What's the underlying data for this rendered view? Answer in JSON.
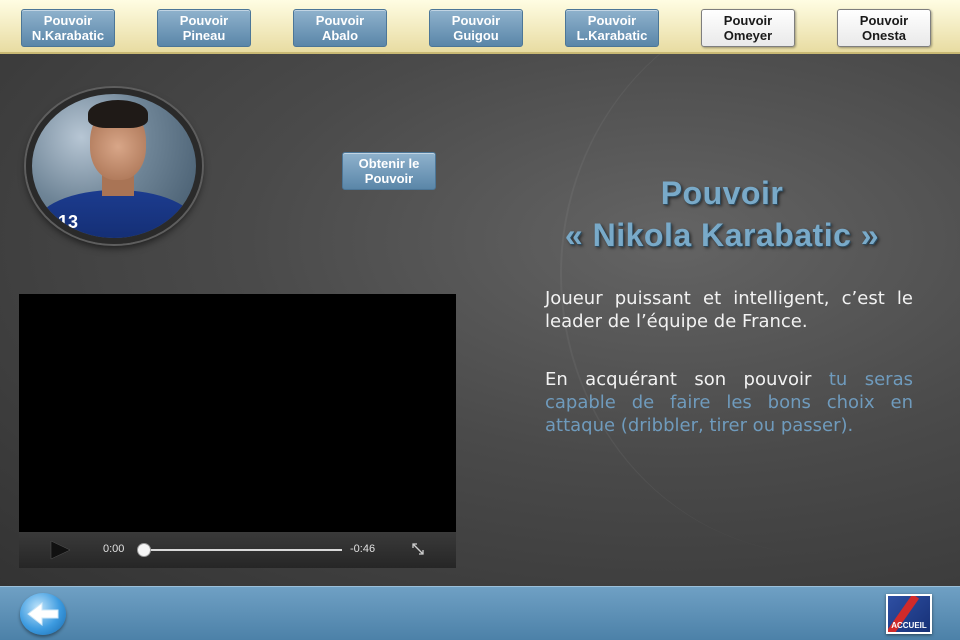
{
  "tabs": [
    {
      "line1": "Pouvoir",
      "line2": "N.Karabatic",
      "style": "blue"
    },
    {
      "line1": "Pouvoir",
      "line2": "Pineau",
      "style": "blue"
    },
    {
      "line1": "Pouvoir",
      "line2": "Abalo",
      "style": "blue"
    },
    {
      "line1": "Pouvoir",
      "line2": "Guigou",
      "style": "blue"
    },
    {
      "line1": "Pouvoir",
      "line2": "L.Karabatic",
      "style": "blue"
    },
    {
      "line1": "Pouvoir",
      "line2": "Omeyer",
      "style": "white"
    },
    {
      "line1": "Pouvoir",
      "line2": "Onesta",
      "style": "white"
    }
  ],
  "player": {
    "jersey_number": "13"
  },
  "obtain_button": {
    "line1": "Obtenir le",
    "line2": "Pouvoir"
  },
  "power": {
    "title_line1": "Pouvoir",
    "title_line2": "« Nikola Karabatic »"
  },
  "description": {
    "paragraph1": "Joueur puissant et intelligent, c’est le leader de l’équipe de France.",
    "paragraph2_plain": "En acquérant son pouvoir ",
    "paragraph2_highlight": "tu seras capable de faire les bons choix en attaque (dribbler, tirer ou passer)."
  },
  "video": {
    "current_time": "0:00",
    "remaining_time": "-0:46",
    "progress": 0
  },
  "bottom": {
    "home_label": "ACCUEIL"
  },
  "colors": {
    "tab_blue": "#6f98b8",
    "title_blue": "#79aac9",
    "highlight_text": "#6f9bbd",
    "bottom_bar": "#5b8db3",
    "top_bar": "#f3ecc2"
  },
  "icons": {
    "play": "play-icon",
    "expand": "expand-icon",
    "back": "back-arrow-icon",
    "home": "accueil-icon"
  }
}
